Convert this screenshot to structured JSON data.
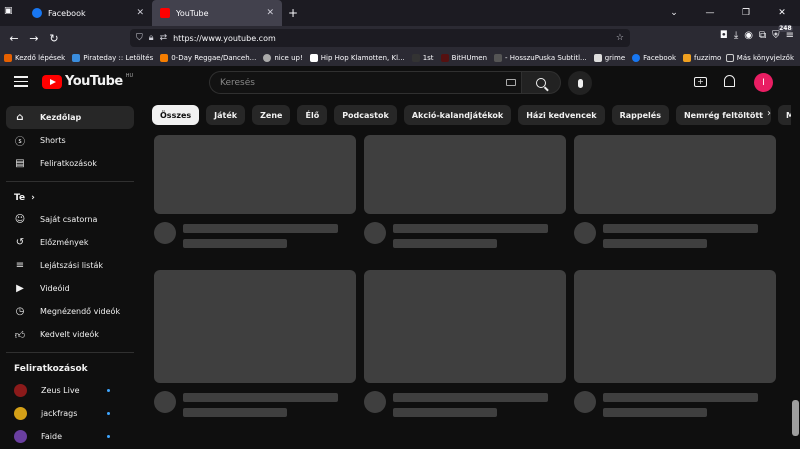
{
  "browser": {
    "tabs": [
      {
        "title": "Facebook",
        "active": false
      },
      {
        "title": "YouTube",
        "active": true
      }
    ],
    "url": "https://www.youtube.com",
    "bookmarks_count_badge": "248",
    "bookmarks": [
      "Kezdő lépések",
      "Pirateday :: Letöltés",
      "0-Day Reggae/Danceh...",
      "nice up!",
      "Hip Hop Klamotten, Kl...",
      "1st",
      "BitHUmen",
      "- HosszuPuska Subtitl...",
      "grime",
      "Facebook",
      "fuzzimo"
    ],
    "other_bookmarks": "Más könyvjelzők"
  },
  "header": {
    "logo_text": "YouTube",
    "country": "HU",
    "search_placeholder": "Keresés",
    "avatar_letter": "I"
  },
  "sidebar": {
    "main": [
      {
        "label": "Kezdőlap",
        "icon": "home-icon"
      },
      {
        "label": "Shorts",
        "icon": "shorts-icon"
      },
      {
        "label": "Feliratkozások",
        "icon": "subscriptions-icon"
      }
    ],
    "you_title": "Te",
    "you": [
      {
        "label": "Saját csatorna",
        "icon": "channel-icon"
      },
      {
        "label": "Előzmények",
        "icon": "history-icon"
      },
      {
        "label": "Lejátszási listák",
        "icon": "playlists-icon"
      },
      {
        "label": "Videóid",
        "icon": "your-videos-icon"
      },
      {
        "label": "Megnézendő videók",
        "icon": "watch-later-icon"
      },
      {
        "label": "Kedvelt videók",
        "icon": "liked-icon"
      }
    ],
    "subs_title": "Feliratkozások",
    "subs": [
      {
        "label": "Zeus Live",
        "color": "#8b1a1a"
      },
      {
        "label": "jackfrags",
        "color": "#d4a017"
      },
      {
        "label": "Faide",
        "color": "#6a3fa0"
      }
    ]
  },
  "chips": [
    "Összes",
    "Játék",
    "Zene",
    "Élő",
    "Podcastok",
    "Akció-kalandjátékok",
    "Házi kedvencek",
    "Rappelés",
    "Nemrég feltöltött",
    "Megnézve"
  ],
  "colors": {
    "accent": "#ff0000",
    "avatar": "#e91e63",
    "new_dot": "#3ea6ff"
  }
}
